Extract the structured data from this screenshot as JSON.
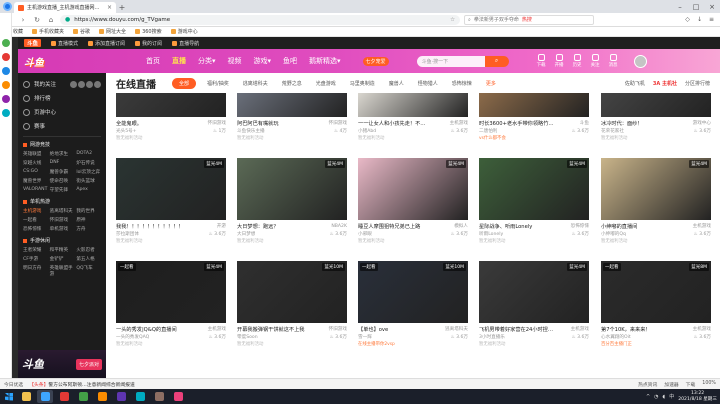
{
  "browser": {
    "tab_title": "主机游戏直播_主机游戏直播网…",
    "url": "https://www.douyu.com/g_TVgame",
    "search_placeholder": "拳法新男子双手夺命",
    "search_hot": "热搜",
    "bookmarks": [
      "收藏",
      "手机收藏夹",
      "谷歌",
      "网址大全",
      "360搜索",
      "游戏中心"
    ]
  },
  "douyu_strip": {
    "logo": "斗鱼",
    "items": [
      "直播模式",
      "添加直播订阅",
      "我的订阅",
      "直播导航"
    ]
  },
  "header": {
    "logo": "斗鱼",
    "nav": [
      {
        "label": "首页",
        "active": false
      },
      {
        "label": "直播",
        "active": true
      },
      {
        "label": "分类▾",
        "active": false
      },
      {
        "label": "视频",
        "active": false
      },
      {
        "label": "游戏▾",
        "active": false
      },
      {
        "label": "鱼吧",
        "active": false
      },
      {
        "label": "鹅斯精选▾",
        "active": false
      }
    ],
    "pill": "七夕宠爱",
    "search_placeholder": "斗鱼·搜一下",
    "icons": [
      {
        "name": "download-icon",
        "label": "下载"
      },
      {
        "name": "live-icon",
        "label": "开播"
      },
      {
        "name": "history-icon",
        "label": "历史"
      },
      {
        "name": "follow-icon",
        "label": "关注"
      },
      {
        "name": "message-icon",
        "label": "消息"
      }
    ]
  },
  "sidebar": {
    "sections": [
      {
        "label": "我的关注"
      },
      {
        "label": "排行榜"
      },
      {
        "label": "页游中心"
      },
      {
        "label": "赛事"
      }
    ],
    "categories": [
      {
        "title": "网游竞技",
        "items": [
          "英雄联盟",
          "绝地求生",
          "DOTA2",
          "穿越火线",
          "DNF",
          "炉石传说",
          "CS:GO",
          "魔兽争霸",
          "lol云顶之弈",
          "魔兽世界",
          "使命召唤",
          "街头篮球",
          "VALORANT",
          "守望先锋",
          "Apex"
        ]
      },
      {
        "title": "单机热游",
        "items": [
          "主机游戏",
          "逃离塔科夫",
          "我的世界",
          "一起看",
          "怀旧游戏",
          "原神",
          "恐怖惊悚",
          "单机游戏",
          "方舟"
        ],
        "highlight": 0
      },
      {
        "title": "手游休闲",
        "items": [
          "王者荣耀",
          "和平精英",
          "火影忍者",
          "CF手游",
          "金铲铲",
          "第五人格",
          "明日方舟",
          "英雄联盟手游",
          "QQ飞车"
        ]
      }
    ],
    "banner_logo": "斗鱼",
    "banner_btn": "七夕派对"
  },
  "main": {
    "title": "在线直播",
    "chips": [
      {
        "label": "全部",
        "active": true
      },
      {
        "label": "福利/抽奖"
      },
      {
        "label": "逃离塔科夫"
      },
      {
        "label": "荒野之息"
      },
      {
        "label": "光盘游戏"
      },
      {
        "label": "马里奥制造"
      },
      {
        "label": "魔兽人"
      },
      {
        "label": "怪物猎人"
      },
      {
        "label": "恐怖惊悚"
      },
      {
        "label": "更多",
        "more": true
      }
    ],
    "right_links": [
      "佐助飞机",
      "3A 主机社",
      "分区排行榜"
    ],
    "top_cards": [
      {
        "title": "全能鬼眼。",
        "cat": "怀旧游戏",
        "streamer": "光头5号+",
        "hot": "1万",
        "tag": "暂无福利活动"
      },
      {
        "title": "阿巴阿巴有嘴就玩",
        "cat": "怀旧游戏",
        "streamer": "斗鱼快乐主播",
        "hot": "4万",
        "tag": "暂无福利活动"
      },
      {
        "title": "一一让女人和小孩先走！不…",
        "cat": "主机游戏",
        "streamer": "小猪Abd",
        "hot": "3.6万",
        "tag": "暂无福利活动"
      },
      {
        "title": "时长3600+老水手带你领略竹…",
        "cat": "斗鱼",
        "streamer": "二唐怕利",
        "hot": "3.6万",
        "tag": "vs什么都不会"
      },
      {
        "title": "冰冷时代：面纱！",
        "cat": "游戏中心",
        "streamer": "花荣花家社",
        "hot": "3.6万",
        "tag": "暂无福利活动"
      }
    ],
    "cards_row2": [
      {
        "title": "我我！！！！！！！！！！！",
        "cat": "开游",
        "streamer": "莎拉斯团体",
        "hot": "3.6万",
        "tag": "暂无福利活动",
        "badge": "蓝光4M"
      },
      {
        "title": "大日梦想：跑远？",
        "cat": "NBA2K",
        "streamer": "大日梦想",
        "hot": "3.6万",
        "tag": "暂无福利活动",
        "badge": "蓝光4M"
      },
      {
        "title": "睡豆人摩围狙特兄弟已上路",
        "cat": "模拟人",
        "streamer": "小邪眼",
        "hot": "3.6万",
        "tag": "暂无福利活动",
        "badge": "蓝光4M"
      },
      {
        "title": "星际战争、听雨Lonely",
        "cat": "恐怖惊悚",
        "streamer": "听雨Lonely",
        "hot": "3.6万",
        "tag": "暂无福利活动",
        "badge": "蓝光4M"
      },
      {
        "title": "小绅嘟的直播间",
        "cat": "主机游戏",
        "streamer": "小绅嘟的Qq",
        "hot": "3.6万",
        "tag": "暂无福利活动",
        "badge": "蓝光4M"
      }
    ],
    "cards_row3": [
      {
        "title": "一头的秀发|Q&Q的直播间",
        "cat": "主机游戏",
        "streamer": "一头的秀发QAQ",
        "hot": "3.6万",
        "tag": "暂无福利活动",
        "badge": "蓝光4M",
        "live": "一起看"
      },
      {
        "title": "开幕我搬弹钢干饼就这不上我",
        "cat": "怀旧游戏",
        "streamer": "零度Soon",
        "hot": "3.6万",
        "tag": "暂无福利活动",
        "badge": "蓝光10M"
      },
      {
        "title": "【单也】ove",
        "cat": "逃离塔科夫",
        "streamer": "雪一辉",
        "hot": "3.6万",
        "tag": "在线主播带你2vsp",
        "badge": "蓝光10M",
        "live": "一起看"
      },
      {
        "title": "飞机男带着好家营在24小时捏…",
        "cat": "主机游戏",
        "streamer": "3小时直播乐",
        "hot": "3.6万",
        "tag": "暂无福利活动",
        "badge": "蓝光4M"
      },
      {
        "title": "第7个10K，来来来！",
        "cat": "主机游戏",
        "streamer": "心水翼翔的Oit",
        "hot": "3.6万",
        "tag": "百分百主播门正",
        "badge": "蓝光8M",
        "live": "一起看"
      }
    ]
  },
  "status": {
    "left": "今日优选",
    "news_tag": "【头条】",
    "news": "警方公布阿斯顿…注意新闻综合新闻报道",
    "right": [
      "热点资讯",
      "加速器",
      "下载",
      "100%"
    ]
  },
  "taskbar": {
    "time": "13:22",
    "date": "2021/8/18 星期三",
    "lang": "中"
  }
}
